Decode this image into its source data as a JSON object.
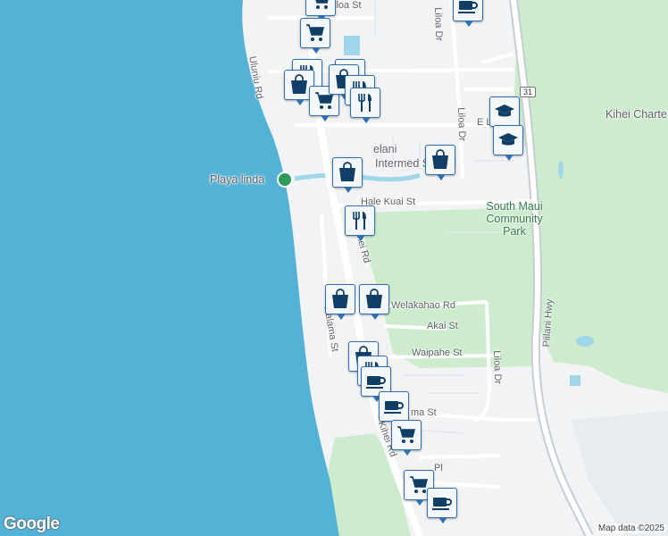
{
  "map": {
    "colors": {
      "water": "#54b2d6",
      "land": "#f2f3f5",
      "park": "#cdeccd",
      "road": "#ffffff",
      "highway": "#c7cdd4",
      "pin_border": "#2c6fb5",
      "pin_icon": "#0f3f66"
    },
    "labels": {
      "uluniu_rd": "Uluniu Rd",
      "liloa_dr_top": "Liloa Dr",
      "liloa_dr_mid": "Liloa Dr",
      "liloa_dr_low": "Liloa Dr",
      "e_st": "E L",
      "kihei_charter": "Kihei Charte",
      "intermediate_school": "Intermed    School",
      "lelani": "elani",
      "playa_linda": "Playa linda",
      "hale_kuai_st": "Hale Kuai St",
      "south_maui_park": "South Maui Community Park",
      "kihei_rd_mid": "hei Rd",
      "welakahao_rd": "Welakahao Rd",
      "akai_st": "Akai St",
      "waipahe_st": "Waipahe St",
      "halama_st": "Halama St",
      "pillani_hwy": "Piilani Hwy",
      "ma_st": "ma St",
      "kihei_rd_low": "Kihei Rd",
      "pl": "Pl",
      "iloa_st": "iloa St",
      "hwy_shield": "31"
    },
    "google_logo": "Google",
    "attribution": "Map data ©2025"
  },
  "pins": [
    {
      "icon": "cart",
      "name": "cart-pin"
    },
    {
      "icon": "coffee",
      "name": "coffee-pin"
    },
    {
      "icon": "cart",
      "name": "cart-pin"
    },
    {
      "icon": "restaurant",
      "name": "restaurant-pin"
    },
    {
      "icon": "shopping-bag",
      "name": "shopping-bag-pin"
    },
    {
      "icon": "cart",
      "name": "cart-pin"
    },
    {
      "icon": "restaurant",
      "name": "restaurant-pin"
    },
    {
      "icon": "shopping-bag",
      "name": "shopping-bag-pin"
    },
    {
      "icon": "restaurant",
      "name": "restaurant-pin"
    },
    {
      "icon": "restaurant",
      "name": "restaurant-pin"
    },
    {
      "icon": "school",
      "name": "school-pin"
    },
    {
      "icon": "school",
      "name": "school-pin"
    },
    {
      "icon": "shopping-bag",
      "name": "shopping-bag-pin"
    },
    {
      "icon": "shopping-bag",
      "name": "shopping-bag-pin"
    },
    {
      "icon": "restaurant",
      "name": "restaurant-pin"
    },
    {
      "icon": "shopping-bag",
      "name": "shopping-bag-pin"
    },
    {
      "icon": "shopping-bag",
      "name": "shopping-bag-pin"
    },
    {
      "icon": "shopping-bag",
      "name": "shopping-bag-pin"
    },
    {
      "icon": "restaurant",
      "name": "restaurant-pin"
    },
    {
      "icon": "coffee",
      "name": "coffee-pin"
    },
    {
      "icon": "coffee",
      "name": "coffee-pin"
    },
    {
      "icon": "cart",
      "name": "cart-pin"
    },
    {
      "icon": "cart",
      "name": "cart-pin"
    },
    {
      "icon": "coffee",
      "name": "coffee-pin"
    }
  ]
}
